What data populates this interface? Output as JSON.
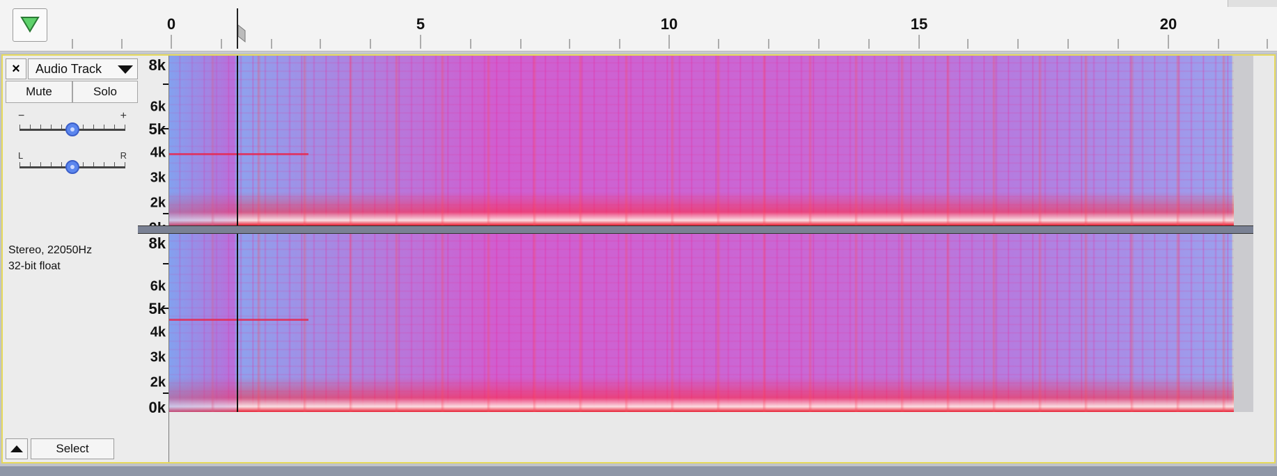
{
  "ruler": {
    "tick_labels": [
      "0",
      "5",
      "10",
      "15",
      "20"
    ]
  },
  "track": {
    "close_label": "×",
    "name": "Audio Track",
    "mute_label": "Mute",
    "solo_label": "Solo",
    "gain": {
      "minus": "−",
      "plus": "+",
      "level": 0.5
    },
    "pan": {
      "left": "L",
      "right": "R",
      "level": 0.5
    },
    "info_line1": "Stereo, 22050Hz",
    "info_line2": "32-bit float",
    "select_label": "Select"
  },
  "channels": [
    {
      "freq_labels": [
        "8k",
        "6k",
        "5k",
        "4k",
        "3k",
        "2k",
        "0k"
      ]
    },
    {
      "freq_labels": [
        "8k",
        "6k",
        "5k",
        "4k",
        "3k",
        "2k",
        "0k"
      ]
    }
  ],
  "colors": {
    "selection_border": "#e6d95a",
    "gain_knob": "#5b86ee",
    "spectrogram_low": "#8ea2ee",
    "spectrogram_high": "#e0306a"
  }
}
